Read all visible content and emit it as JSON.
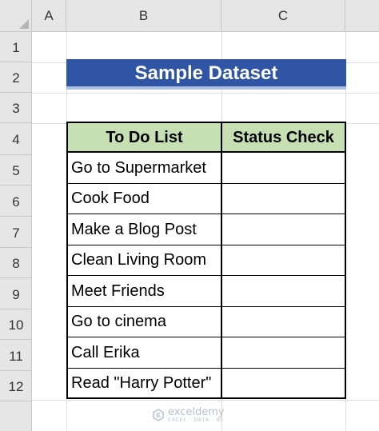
{
  "sheet": {
    "column_headers": [
      "A",
      "B",
      "C"
    ],
    "row_headers": [
      "1",
      "2",
      "3",
      "4",
      "5",
      "6",
      "7",
      "8",
      "9",
      "10",
      "11",
      "12"
    ]
  },
  "title_banner": "Sample Dataset",
  "table": {
    "headers": [
      "To Do List",
      "Status Check"
    ],
    "rows": [
      {
        "todo": "Go to Supermarket",
        "status": ""
      },
      {
        "todo": "Cook Food",
        "status": ""
      },
      {
        "todo": "Make a Blog Post",
        "status": ""
      },
      {
        "todo": "Clean Living Room",
        "status": ""
      },
      {
        "todo": "Meet Friends",
        "status": ""
      },
      {
        "todo": "Go to cinema",
        "status": ""
      },
      {
        "todo": "Call Erika",
        "status": ""
      },
      {
        "todo": "Read \"Harry Potter\"",
        "status": ""
      }
    ]
  },
  "colors": {
    "title_bg": "#2f55a4",
    "header_bg": "#c6e0b4",
    "header_band": "#e6e6e6"
  },
  "watermark": {
    "name": "exceldemy",
    "tagline": "EXCEL · DATA · BI",
    "icon": "exceldemy-logo-icon"
  }
}
